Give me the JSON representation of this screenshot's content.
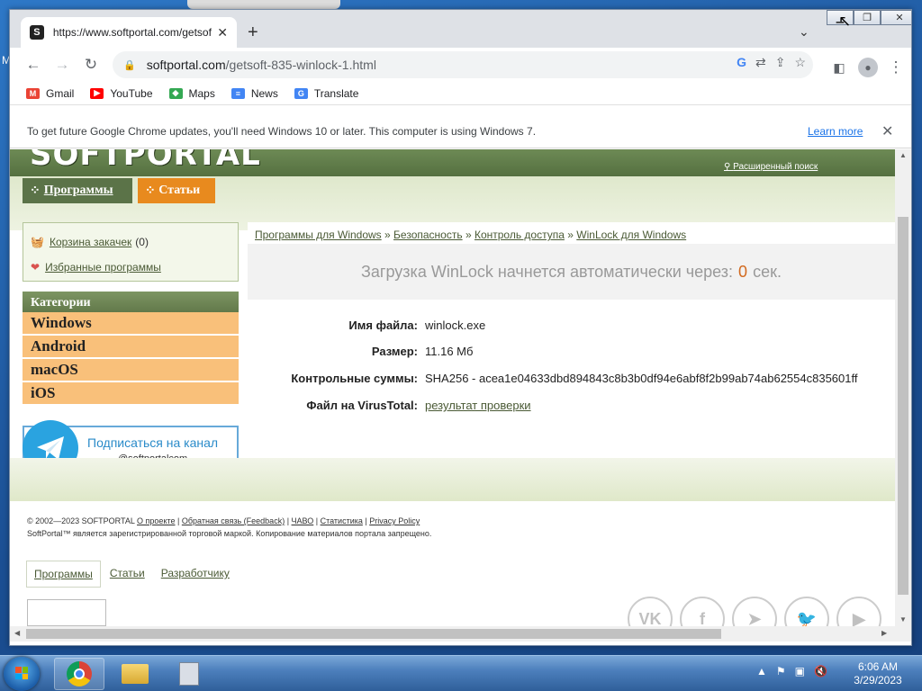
{
  "desktop": {
    "edge_letter": "M"
  },
  "browser": {
    "tab_title": "https://www.softportal.com/getsoft",
    "tab_close": "✕",
    "url_host": "softportal.com",
    "url_path": "/getsoft-835-winlock-1.html",
    "bookmarks": [
      {
        "label": "Gmail",
        "icon": "gmail-icon",
        "color": "#ea4335"
      },
      {
        "label": "YouTube",
        "icon": "youtube-icon",
        "color": "#ff0000"
      },
      {
        "label": "Maps",
        "icon": "maps-icon",
        "color": "#34a853"
      },
      {
        "label": "News",
        "icon": "news-icon",
        "color": "#4285f4"
      },
      {
        "label": "Translate",
        "icon": "translate-icon",
        "color": "#4285f4"
      }
    ],
    "infobar": {
      "message": "To get future Google Chrome updates, you'll need Windows 10 or later. This computer is using Windows 7.",
      "learn_more": "Learn more"
    }
  },
  "site": {
    "logo": "SOFTPORTAL",
    "advanced_search": "Расширенный поиск",
    "nav": {
      "programs": "Программы",
      "articles": "Статьи"
    },
    "cart": {
      "label": "Корзина закачек",
      "count": "(0)",
      "favorites": "Избранные программы"
    },
    "categories": {
      "title": "Категории",
      "items": [
        "Windows",
        "Android",
        "macOS",
        "iOS"
      ]
    },
    "telegram": {
      "line1": "Подписаться на канал",
      "line2": "@softportalcom"
    },
    "breadcrumb": [
      "Программы для Windows",
      "Безопасность",
      "Контроль доступа",
      "WinLock для Windows"
    ],
    "breadcrumb_sep": "»",
    "download": {
      "prefix": "Загрузка WinLock начнется автоматически через:",
      "seconds": "0",
      "suffix": "сек."
    },
    "file_info": [
      {
        "label": "Имя файла:",
        "value": "winlock.exe"
      },
      {
        "label": "Размер:",
        "value": "11.16 Мб"
      },
      {
        "label": "Контрольные суммы:",
        "value": "SHA256 - acea1e04633dbd894843c8b3b0df94e6abf8f2b99ab74ab62554c835601ff"
      },
      {
        "label": "Файл на VirusTotal:",
        "value": "результат проверки"
      }
    ],
    "footer": {
      "copyright": "© 2002—2023 SOFTPORTAL",
      "links": [
        "О проекте",
        "Обратная связь (Feedback)",
        "ЧАВО",
        "Статистика",
        "Privacy Policy"
      ],
      "trademark": "SoftPortal™ является зарегистрированной торговой маркой. Копирование материалов портала запрещено.",
      "tabs": [
        "Программы",
        "Статьи",
        "Разработчику"
      ],
      "social": [
        {
          "name": "vk-icon",
          "glyph": "VK"
        },
        {
          "name": "facebook-icon",
          "glyph": "f"
        },
        {
          "name": "telegram-icon",
          "glyph": "➤"
        },
        {
          "name": "twitter-icon",
          "glyph": "🐦"
        },
        {
          "name": "youtube-icon",
          "glyph": "▶"
        }
      ]
    }
  },
  "taskbar": {
    "time": "6:06 AM",
    "date": "3/29/2023"
  }
}
